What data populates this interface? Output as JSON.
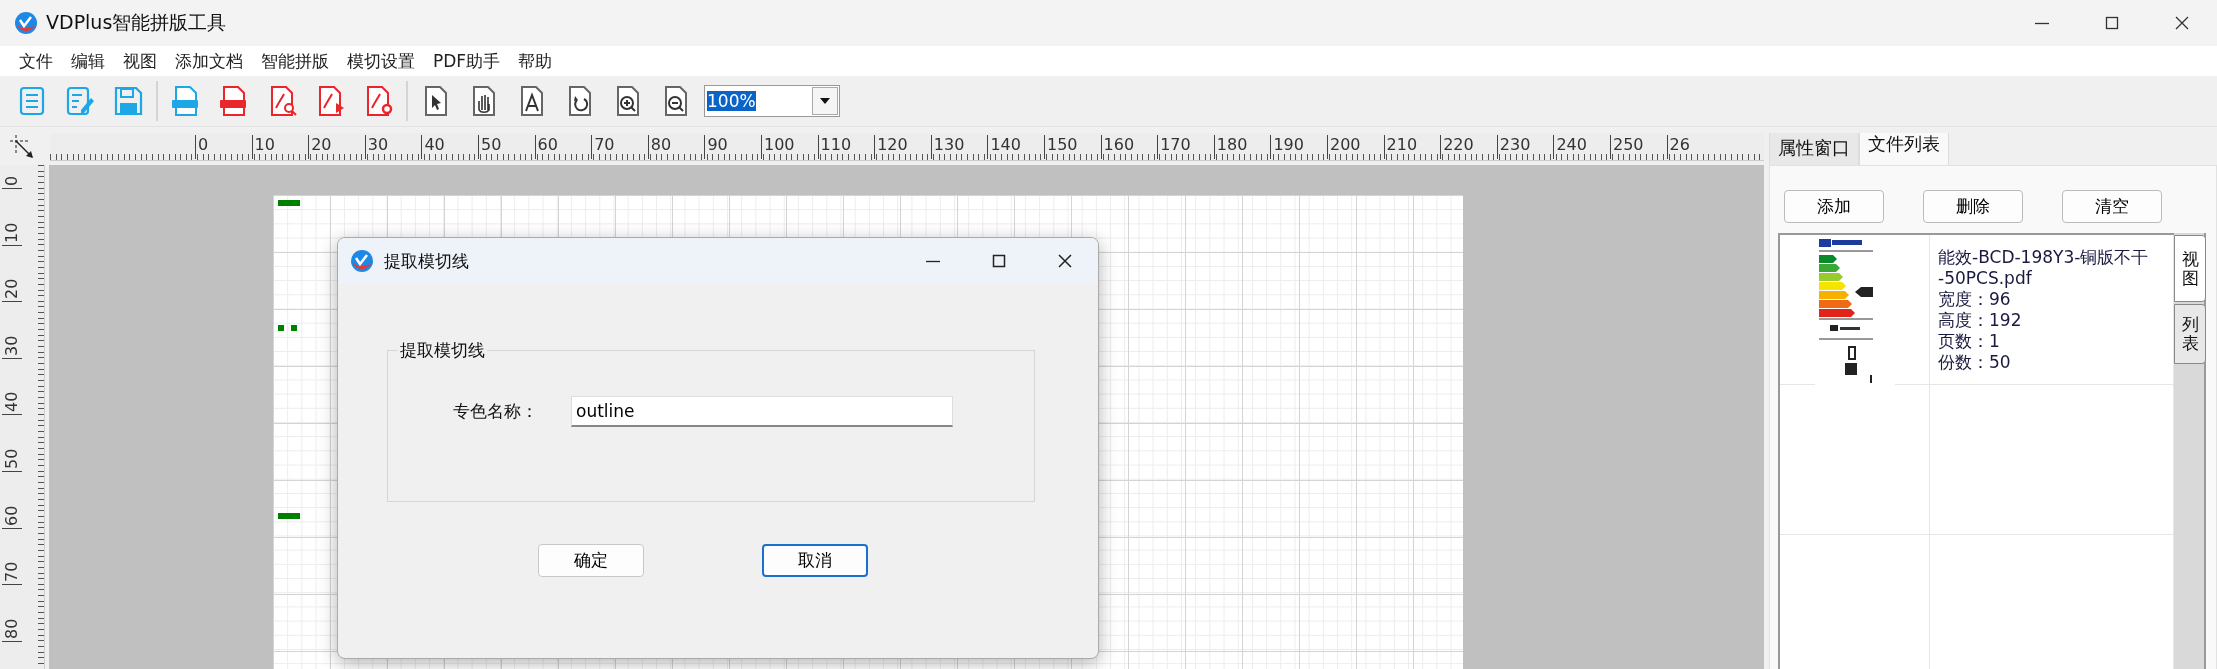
{
  "window": {
    "title": "VDPlus智能拼版工具"
  },
  "menu": [
    "文件",
    "编辑",
    "视图",
    "添加文档",
    "智能拼版",
    "模切设置",
    "PDF助手",
    "帮助"
  ],
  "toolbar": {
    "zoom": {
      "value": "100%",
      "text_selected": true
    }
  },
  "ruler": {
    "horizontal": [
      "0",
      "10",
      "20",
      "30",
      "40",
      "50",
      "60",
      "70",
      "80",
      "90",
      "100",
      "110",
      "120",
      "130",
      "140",
      "150",
      "160",
      "170",
      "180",
      "190",
      "200",
      "210",
      "220",
      "230",
      "240",
      "250",
      "26"
    ],
    "vertical": [
      "0",
      "10",
      "20",
      "30",
      "40",
      "50",
      "60",
      "70",
      "80"
    ]
  },
  "panel": {
    "tabs": [
      {
        "label": "属性窗口",
        "selected": false
      },
      {
        "label": "文件列表",
        "selected": true
      }
    ],
    "buttons": [
      "添加",
      "删除",
      "清空"
    ],
    "files": [
      {
        "name_line_1": "能效-BCD-198Y3-铜版不干",
        "name_line_2": "-50PCS.pdf",
        "fields": [
          {
            "label": "宽度：",
            "value": "96"
          },
          {
            "label": "高度：",
            "value": "192"
          },
          {
            "label": "页数：",
            "value": "1"
          },
          {
            "label": "份数：",
            "value": "50"
          }
        ]
      }
    ],
    "side_tabs": [
      {
        "label": "视图",
        "selected": true
      },
      {
        "label": "列表",
        "selected": false
      }
    ]
  },
  "dialog": {
    "title": "提取模切线",
    "group": "提取模切线",
    "field_label": "专色名称：",
    "field_value": "outline",
    "buttons": [
      {
        "label": "确定",
        "focused": false
      },
      {
        "label": "取消",
        "focused": true
      }
    ]
  }
}
